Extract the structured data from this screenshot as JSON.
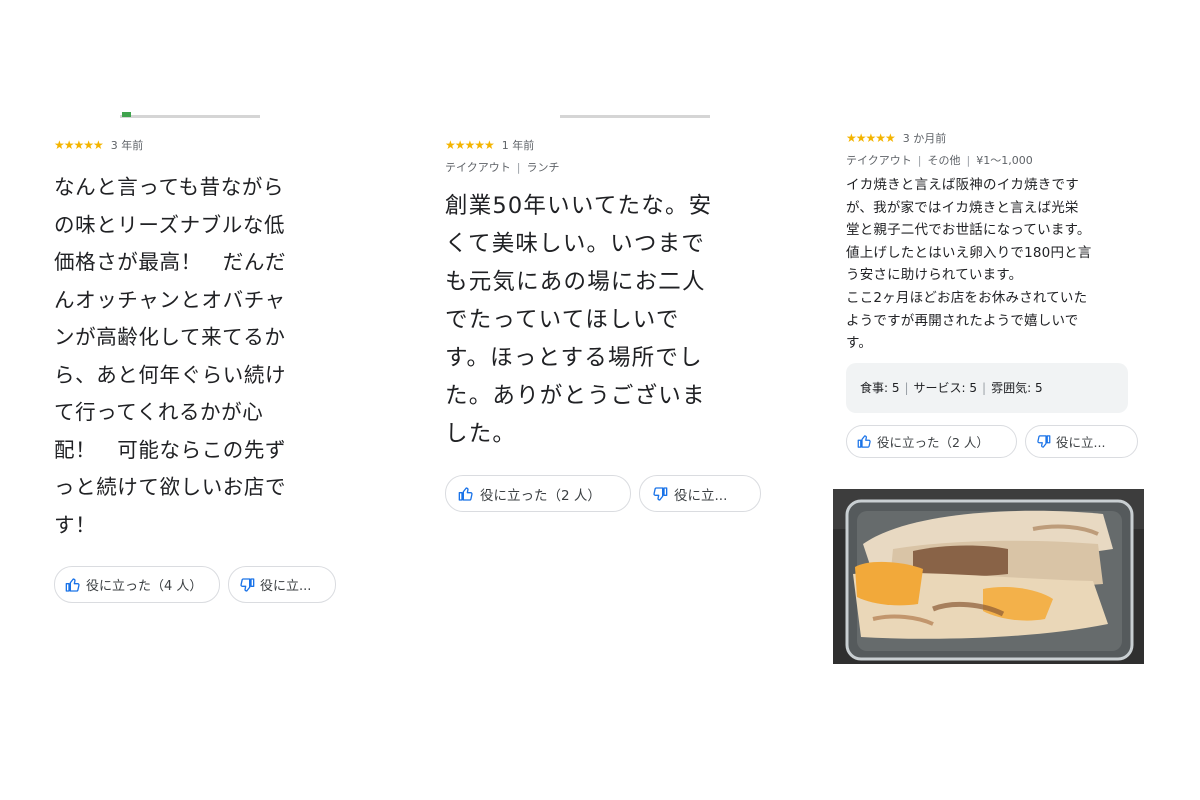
{
  "reviews": [
    {
      "stars": "★★★★★",
      "time": "3 年前",
      "text": "なんと言っても昔ながらの味とリーズナブルな低価格さが最高！　だんだんオッチャンとオバチャンが高齢化して来てるから、あと何年ぐらい続けて行ってくれるかが心配！　可能ならこの先ずっと続けて欲しいお店です！",
      "lines": [
        "なんと言っても昔ながら",
        "の味とリーズナブルな低",
        "価格さが最高！　だんだ",
        "んオッチャンとオバチャ",
        "ンが高齢化して来てるか",
        "ら、あと何年ぐらい続け",
        "て行ってくれるかが心",
        "配！　可能ならこの先ず",
        "っと続けて欲しいお店で",
        "す！"
      ],
      "helpful_label": "役に立った（4 人）",
      "not_helpful_label": "役に立..."
    },
    {
      "stars": "★★★★★",
      "time": "1 年前",
      "tags": [
        "テイクアウト",
        "ランチ"
      ],
      "lines": [
        "創業50年いいてたな。安",
        "くて美味しい。いつまで",
        "も元気にあの場にお二人",
        "でたっていてほしいで",
        "す。ほっとする場所でし",
        "た。ありがとうございま",
        "した。"
      ],
      "helpful_label": "役に立った（2 人）",
      "not_helpful_label": "役に立..."
    },
    {
      "stars": "★★★★★",
      "time": "3 か月前",
      "tags": [
        "テイクアウト",
        "その他",
        "¥1～1,000"
      ],
      "lines": [
        "イカ焼きと言えば阪神のイカ焼きです",
        "が、我が家ではイカ焼きと言えば光栄",
        "堂と親子二代でお世話になっています。",
        "値上げしたとはいえ卵入りで180円と言",
        "う安さに助けられています。",
        "ここ2ヶ月ほどお店をお休みされていた",
        "ようですが再開されたようで嬉しいで",
        "す。"
      ],
      "ratings": [
        "食事: 5",
        "サービス: 5",
        "雰囲気: 5"
      ],
      "helpful_label": "役に立った（2 人）",
      "not_helpful_label": "役に立..."
    }
  ],
  "colors": {
    "star": "#f4b400",
    "button_icon": "#1a73e8",
    "muted_text": "#5f6368"
  },
  "icons": [
    "thumbs-up-icon",
    "thumbs-down-icon"
  ]
}
